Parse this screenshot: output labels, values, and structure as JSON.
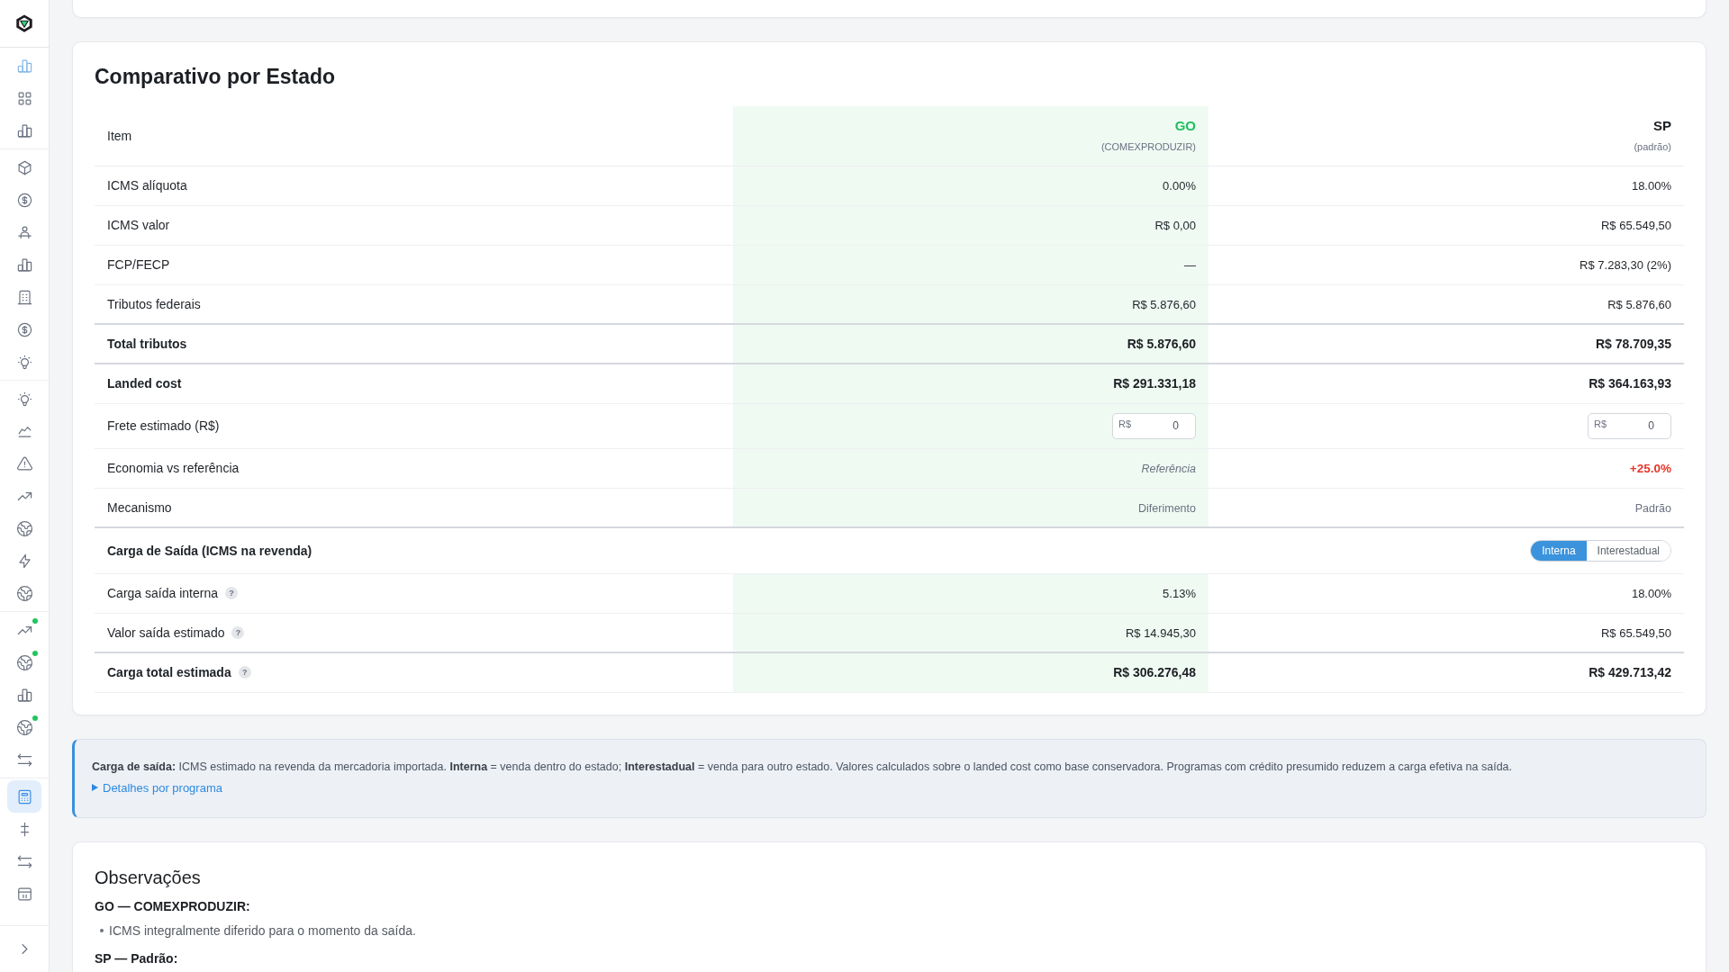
{
  "sidebar": {
    "groups": [
      {
        "items": [
          {
            "selected": false,
            "highlighted": true,
            "dot": false
          },
          {
            "selected": false,
            "highlighted": false,
            "dot": false
          },
          {
            "selected": false,
            "highlighted": false,
            "dot": false
          }
        ]
      },
      {
        "items": [
          {
            "selected": false,
            "highlighted": false,
            "dot": false
          },
          {
            "selected": false,
            "highlighted": false,
            "dot": false
          },
          {
            "selected": false,
            "highlighted": false,
            "dot": false
          },
          {
            "selected": false,
            "highlighted": false,
            "dot": false
          },
          {
            "selected": false,
            "highlighted": false,
            "dot": false
          },
          {
            "selected": false,
            "highlighted": false,
            "dot": false
          },
          {
            "selected": false,
            "highlighted": false,
            "dot": false
          }
        ]
      },
      {
        "items": [
          {
            "selected": false,
            "highlighted": false,
            "dot": false
          },
          {
            "selected": false,
            "highlighted": false,
            "dot": false
          },
          {
            "selected": false,
            "highlighted": false,
            "dot": false
          },
          {
            "selected": false,
            "highlighted": false,
            "dot": false
          },
          {
            "selected": false,
            "highlighted": false,
            "dot": false
          },
          {
            "selected": false,
            "highlighted": false,
            "dot": false
          },
          {
            "selected": false,
            "highlighted": false,
            "dot": false
          }
        ]
      },
      {
        "items": [
          {
            "selected": false,
            "highlighted": false,
            "dot": true
          },
          {
            "selected": false,
            "highlighted": false,
            "dot": true
          },
          {
            "selected": false,
            "highlighted": false,
            "dot": false
          },
          {
            "selected": false,
            "highlighted": false,
            "dot": true
          },
          {
            "selected": false,
            "highlighted": false,
            "dot": false
          }
        ]
      },
      {
        "items": [
          {
            "selected": true,
            "highlighted": false,
            "dot": false
          },
          {
            "selected": false,
            "highlighted": false,
            "dot": false
          },
          {
            "selected": false,
            "highlighted": false,
            "dot": false
          },
          {
            "selected": false,
            "highlighted": false,
            "dot": false
          }
        ]
      }
    ]
  },
  "comparison": {
    "title": "Comparativo por Estado",
    "item_header": "Item",
    "states": [
      {
        "code": "GO",
        "program": "(COMEXPRODUZIR)",
        "highlighted": true
      },
      {
        "code": "SP",
        "program": "(padrão)",
        "highlighted": false
      }
    ],
    "rows": [
      {
        "kind": "value",
        "label": "ICMS alíquota",
        "cells": [
          {
            "text": "0.00%"
          },
          {
            "text": "18.00%"
          }
        ]
      },
      {
        "kind": "value",
        "label": "ICMS valor",
        "cells": [
          {
            "text": "R$ 0,00"
          },
          {
            "text": "R$ 65.549,50"
          }
        ]
      },
      {
        "kind": "value",
        "label": "FCP/FECP",
        "cells": [
          {
            "text": "—"
          },
          {
            "text": "R$ 7.283,30 (2%)"
          }
        ]
      },
      {
        "kind": "value",
        "label": "Tributos federais",
        "cells": [
          {
            "text": "R$ 5.876,60"
          },
          {
            "text": "R$ 5.876,60"
          }
        ]
      },
      {
        "kind": "total",
        "label": "Total tributos",
        "cells": [
          {
            "text": "R$ 5.876,60"
          },
          {
            "text": "R$ 78.709,35"
          }
        ]
      },
      {
        "kind": "total",
        "label": "Landed cost",
        "cells": [
          {
            "text": "R$ 291.331,18"
          },
          {
            "text": "R$ 364.163,93"
          }
        ]
      },
      {
        "kind": "input",
        "label": "Frete estimado (R$)",
        "cells": [
          {
            "prefix": "R$",
            "value": "0"
          },
          {
            "prefix": "R$",
            "value": "0"
          }
        ]
      },
      {
        "kind": "value",
        "label": "Economia vs referência",
        "cells": [
          {
            "text": "Referência",
            "kind": "reference"
          },
          {
            "text": "+25.0%",
            "kind": "increase"
          }
        ]
      },
      {
        "kind": "note",
        "label": "Mecanismo",
        "cells": [
          {
            "text": "Diferimento"
          },
          {
            "text": "Padrão"
          }
        ]
      },
      {
        "kind": "section",
        "label": "Carga de Saída (ICMS na revenda)",
        "options": [
          {
            "label": "Interna",
            "selected": true
          },
          {
            "label": "Interestadual",
            "selected": false
          }
        ]
      },
      {
        "kind": "value",
        "label": "Carga saída interna",
        "help": "?",
        "cells": [
          {
            "text": "5.13%"
          },
          {
            "text": "18.00%"
          }
        ]
      },
      {
        "kind": "value",
        "label": "Valor saída estimado",
        "help": "?",
        "cells": [
          {
            "text": "R$ 14.945,30"
          },
          {
            "text": "R$ 65.549,50"
          }
        ]
      },
      {
        "kind": "total",
        "label": "Carga total estimada",
        "help": "?",
        "cells": [
          {
            "text": "R$ 306.276,48"
          },
          {
            "text": "R$ 429.713,42"
          }
        ]
      }
    ]
  },
  "info": {
    "text": "**Carga de saída:** ICMS estimado na revenda da mercadoria importada. **Interna** = venda dentro do estado; **Interestadual** = venda para outro estado. Valores calculados sobre o landed cost como base conservadora. Programas com crédito presumido reduzem a carga efetiva na saída.",
    "link": "Detalhes por programa",
    "expanded": false
  },
  "observations": {
    "title": "Observações",
    "groups": [
      {
        "heading": "GO — COMEXPRODUZIR:",
        "items": [
          "ICMS integralmente diferido para o momento da saída."
        ]
      },
      {
        "heading": "SP — Padrão:"
      }
    ]
  }
}
